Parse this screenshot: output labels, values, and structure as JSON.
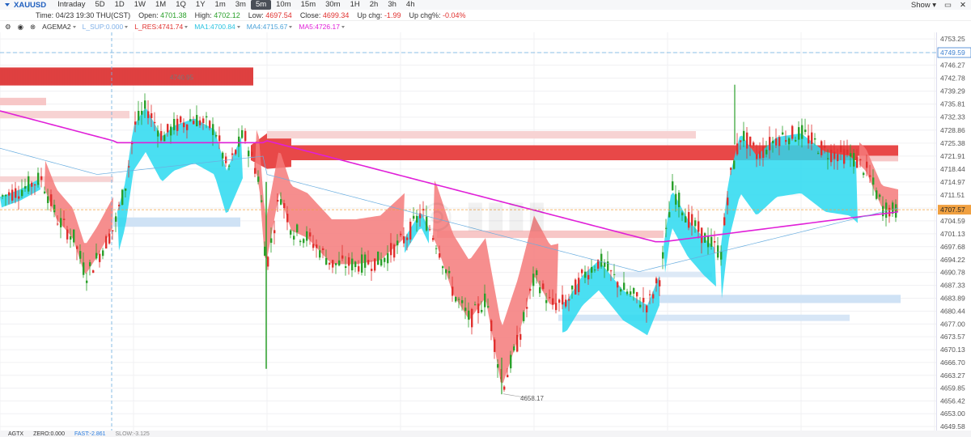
{
  "toolbar": {
    "symbol": "XAUUSD",
    "timeframes": [
      "Intraday",
      "5D",
      "1D",
      "1W",
      "1M",
      "1Q",
      "1Y",
      "1m",
      "3m",
      "5m",
      "10m",
      "15m",
      "30m",
      "1H",
      "2h",
      "3h",
      "4h"
    ],
    "active": "5m",
    "show_label": "Show"
  },
  "info": {
    "time_label": "Time:",
    "time": "04/23 19:30 THU(CST)",
    "open_label": "Open:",
    "open": "4701.38",
    "high_label": "High:",
    "high": "4702.12",
    "low_label": "Low:",
    "low": "4697.54",
    "close_label": "Close:",
    "close": "4699.34",
    "chg_label": "Up chg:",
    "chg": "-1.99",
    "chgp_label": "Up chg%:",
    "chgp": "-0.04%"
  },
  "indicators": {
    "name": "AGEMA2",
    "sup": "L_SUP:0.000",
    "res": "L_RES:4741.74",
    "ma1": "MA1:4700.84",
    "ma4": "MA4:4715.67",
    "ma5": "MA5:4726.17",
    "colors": {
      "sup": "#7fb0e8",
      "res": "#e0302e",
      "ma1": "#29c3e0",
      "ma4": "#4da3d9",
      "ma5": "#e020d8"
    }
  },
  "bottom": {
    "name": "AGTX",
    "zero": "ZERO:0.000",
    "fast": "FAST:-2.861",
    "slow": "SLOW:-3.125"
  },
  "price_axis": {
    "ticks": [
      "4753.25",
      "4749.59",
      "4746.27",
      "4742.78",
      "4739.29",
      "4735.81",
      "4732.33",
      "4728.86",
      "4725.38",
      "4721.91",
      "4718.44",
      "4714.97",
      "4711.51",
      "4708.04",
      "4707.57",
      "4704.59",
      "4701.13",
      "4697.68",
      "4694.22",
      "4690.78",
      "4687.33",
      "4683.89",
      "4680.44",
      "4677.00",
      "4673.57",
      "4670.13",
      "4666.70",
      "4663.27",
      "4659.85",
      "4656.42",
      "4653.00",
      "4649.58"
    ],
    "highlight_blue": "4749.59",
    "highlight_orange": "4707.57"
  },
  "annotations": {
    "high": "4740.95",
    "low": "4658.17"
  },
  "colors": {
    "up": "#2aa02a",
    "down": "#e0302e",
    "cloud_up": "#2ad9f0",
    "cloud_down": "#f47a7a",
    "ma_long": "#e020d8",
    "ma_blue": "#6aaee0"
  }
}
